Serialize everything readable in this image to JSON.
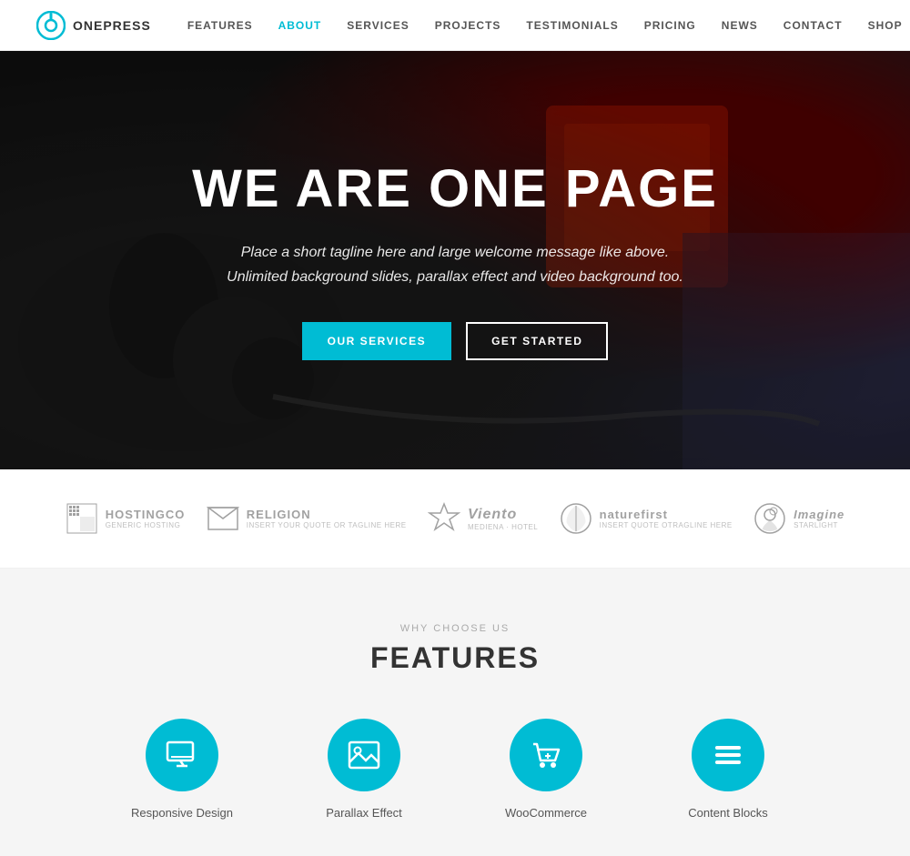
{
  "header": {
    "logo_text": "ONEPRESS",
    "nav_items": [
      {
        "label": "FEATURES",
        "active": false
      },
      {
        "label": "ABOUT",
        "active": true
      },
      {
        "label": "SERVICES",
        "active": false
      },
      {
        "label": "PROJECTS",
        "active": false
      },
      {
        "label": "TESTIMONIALS",
        "active": false
      },
      {
        "label": "PRICING",
        "active": false
      },
      {
        "label": "NEWS",
        "active": false
      },
      {
        "label": "CONTACT",
        "active": false
      },
      {
        "label": "SHOP",
        "active": false
      }
    ]
  },
  "hero": {
    "title": "WE ARE ONE PAGE",
    "subtitle_line1": "Place a short tagline here and large welcome message like above.",
    "subtitle_line2": "Unlimited background slides, parallax effect and video background too.",
    "btn_primary": "OUR SERVICES",
    "btn_secondary": "GET STARTED"
  },
  "logos": [
    {
      "name": "HOSTINGCO",
      "sub": "GENERIC HOSTING"
    },
    {
      "name": "RELIGION",
      "sub": "INSERT YOUR QUOTE OR TAGLINE HERE"
    },
    {
      "name": "Viento",
      "sub": "MEDIENA · HOTEL"
    },
    {
      "name": "naturefirst",
      "sub": "INSERT QUOTE OTRAGLINE HERE"
    },
    {
      "name": "Imagine",
      "sub": "STARLIGHT"
    }
  ],
  "features_section": {
    "label": "WHY CHOOSE US",
    "title": "FEATURES",
    "items": [
      {
        "label": "Responsive Design",
        "icon": "monitor"
      },
      {
        "label": "Parallax Effect",
        "icon": "image"
      },
      {
        "label": "WooCommerce",
        "icon": "cart"
      },
      {
        "label": "Content Blocks",
        "icon": "menu"
      }
    ]
  },
  "colors": {
    "accent": "#00bcd4",
    "text_dark": "#333333",
    "text_muted": "#aaaaaa"
  }
}
